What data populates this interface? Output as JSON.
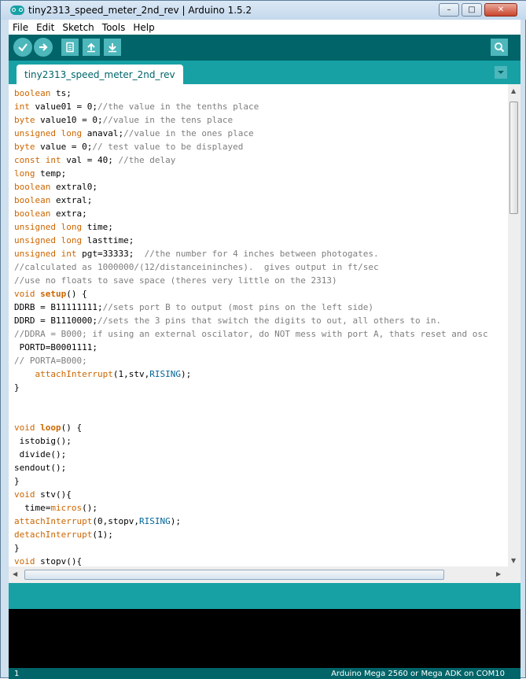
{
  "window": {
    "title": "tiny2313_speed_meter_2nd_rev | Arduino 1.5.2",
    "controls": {
      "minimize": "–",
      "maximize": "□",
      "close": "✕"
    }
  },
  "menu": [
    "File",
    "Edit",
    "Sketch",
    "Tools",
    "Help"
  ],
  "toolbar": {
    "buttons": [
      "verify-icon",
      "upload-icon",
      "new-icon",
      "open-icon",
      "save-icon"
    ],
    "serial_monitor": "serial-monitor-icon"
  },
  "tabs": [
    {
      "label": "tiny2313_speed_meter_2nd_rev"
    }
  ],
  "code_lines": [
    [
      {
        "t": "boolean",
        "c": "kw"
      },
      {
        "t": " ts;"
      }
    ],
    [
      {
        "t": "int",
        "c": "kw"
      },
      {
        "t": " value01 = 0;"
      },
      {
        "t": "//the value in the tenths place",
        "c": "cm"
      }
    ],
    [
      {
        "t": "byte",
        "c": "kw"
      },
      {
        "t": " value10 = 0;"
      },
      {
        "t": "//value in the tens place",
        "c": "cm"
      }
    ],
    [
      {
        "t": "unsigned",
        "c": "kw"
      },
      {
        "t": " "
      },
      {
        "t": "long",
        "c": "kw"
      },
      {
        "t": " anaval;"
      },
      {
        "t": "//value in the ones place",
        "c": "cm"
      }
    ],
    [
      {
        "t": "byte",
        "c": "kw"
      },
      {
        "t": " value = 0;"
      },
      {
        "t": "// test value to be displayed",
        "c": "cm"
      }
    ],
    [
      {
        "t": "const",
        "c": "kw"
      },
      {
        "t": " "
      },
      {
        "t": "int",
        "c": "kw"
      },
      {
        "t": " val = 40; "
      },
      {
        "t": "//the delay",
        "c": "cm"
      }
    ],
    [
      {
        "t": "long",
        "c": "kw"
      },
      {
        "t": " temp;"
      }
    ],
    [
      {
        "t": "boolean",
        "c": "kw"
      },
      {
        "t": " extral0;"
      }
    ],
    [
      {
        "t": "boolean",
        "c": "kw"
      },
      {
        "t": " extral;"
      }
    ],
    [
      {
        "t": "boolean",
        "c": "kw"
      },
      {
        "t": " extra;"
      }
    ],
    [
      {
        "t": "unsigned",
        "c": "kw"
      },
      {
        "t": " "
      },
      {
        "t": "long",
        "c": "kw"
      },
      {
        "t": " time;"
      }
    ],
    [
      {
        "t": "unsigned",
        "c": "kw"
      },
      {
        "t": " "
      },
      {
        "t": "long",
        "c": "kw"
      },
      {
        "t": " lasttime;"
      }
    ],
    [
      {
        "t": "unsigned",
        "c": "kw"
      },
      {
        "t": " "
      },
      {
        "t": "int",
        "c": "kw"
      },
      {
        "t": " pgt=33333;  "
      },
      {
        "t": "//the number for 4 inches between photogates.",
        "c": "cm"
      }
    ],
    [
      {
        "t": "//calculated as 1000000/(12/distanceininches).  gives output in ft/sec",
        "c": "cm"
      }
    ],
    [
      {
        "t": "//use no floats to save space (theres very little on the 2313)",
        "c": "cm"
      }
    ],
    [
      {
        "t": "void",
        "c": "kw"
      },
      {
        "t": " "
      },
      {
        "t": "setup",
        "c": "fn"
      },
      {
        "t": "() {"
      }
    ],
    [
      {
        "t": "DDRB = B11111111;"
      },
      {
        "t": "//sets port B to output (most pins on the left side)",
        "c": "cm"
      }
    ],
    [
      {
        "t": "DDRD = B1110000;"
      },
      {
        "t": "//sets the 3 pins that switch the digits to out, all others to in.",
        "c": "cm"
      }
    ],
    [
      {
        "t": "//DDRA = B000; if using an external oscilator, do NOT mess with port A, thats reset and osc",
        "c": "cm"
      }
    ],
    [
      {
        "t": " PORTD=B0001111;"
      }
    ],
    [
      {
        "t": "// PORTA=B000;",
        "c": "cm"
      }
    ],
    [
      {
        "t": "    "
      },
      {
        "t": "attachInterrupt",
        "c": "kw"
      },
      {
        "t": "(1,stv,"
      },
      {
        "t": "RISING",
        "c": "cn"
      },
      {
        "t": ");"
      }
    ],
    [
      {
        "t": "}"
      }
    ],
    [
      {
        "t": ""
      }
    ],
    [
      {
        "t": ""
      }
    ],
    [
      {
        "t": "void",
        "c": "kw"
      },
      {
        "t": " "
      },
      {
        "t": "loop",
        "c": "fn"
      },
      {
        "t": "() {"
      }
    ],
    [
      {
        "t": " istobig();"
      }
    ],
    [
      {
        "t": " divide();"
      }
    ],
    [
      {
        "t": "sendout();"
      }
    ],
    [
      {
        "t": "}"
      }
    ],
    [
      {
        "t": "void",
        "c": "kw"
      },
      {
        "t": " stv(){"
      }
    ],
    [
      {
        "t": "  time="
      },
      {
        "t": "micros",
        "c": "kw"
      },
      {
        "t": "();"
      }
    ],
    [
      {
        "t": "attachInterrupt",
        "c": "kw"
      },
      {
        "t": "(0,stopv,"
      },
      {
        "t": "RISING",
        "c": "cn"
      },
      {
        "t": ");"
      }
    ],
    [
      {
        "t": "detachInterrupt",
        "c": "kw"
      },
      {
        "t": "(1);"
      }
    ],
    [
      {
        "t": "}"
      }
    ],
    [
      {
        "t": "void",
        "c": "kw"
      },
      {
        "t": " stopv(){"
      }
    ]
  ],
  "status": {
    "line_number": "1",
    "board": "Arduino Mega 2560 or Mega ADK on COM10"
  },
  "colors": {
    "toolbar": "#006468",
    "tabbar": "#17a1a5",
    "keyword": "#cc6600",
    "comment": "#7e7e7e",
    "constant": "#006699"
  }
}
